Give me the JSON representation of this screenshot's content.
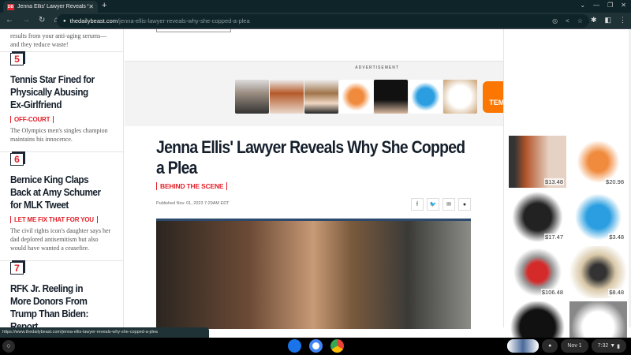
{
  "browser": {
    "tab_title": "Jenna Ellis' Lawyer Reveals Why",
    "favicon": "DB",
    "url_domain": "thedailybeast.com",
    "url_path": "/jenna-ellis-lawyer-reveals-why-she-copped-a-plea",
    "status_url": "https://www.thedailybeast.com/jenna-ellis-lawyer-reveals-why-she-copped-a-plea"
  },
  "sidebar": {
    "lead_text": "results from your anti-aging serums—and they reduce waste!",
    "items": [
      {
        "num": "5",
        "title": "Tennis Star Fined for Physically Abusing Ex-Girlfriend",
        "tag": "OFF-COURT",
        "desc": "The Olympics men's singles champion maintains his innocence."
      },
      {
        "num": "6",
        "title": "Bernice King Claps Back at Amy Schumer for MLK Tweet",
        "tag": "LET ME FIX THAT FOR YOU",
        "desc": "The civil rights icon's daughter says her dad deplored antisemitism but also would have wanted a ceasefire."
      },
      {
        "num": "7",
        "title": "RFK Jr. Reeling in More Donors From Trump Than Biden: Report",
        "tag": "",
        "desc": ""
      }
    ]
  },
  "ad": {
    "label": "ADVERTISEMENT",
    "brand": "TEMU"
  },
  "article": {
    "title": "Jenna Ellis' Lawyer Reveals Why She Copped a Plea",
    "tag": "BEHIND THE SCENE",
    "published": "Published Nov. 01, 2023 7:29AM EDT"
  },
  "right_ads": {
    "prices": [
      "$13.48",
      "$20.98",
      "$17.47",
      "$3.48",
      "$106.48",
      "$8.48",
      "",
      ""
    ]
  },
  "shelf": {
    "date": "Nov 1",
    "time": "7:32"
  }
}
